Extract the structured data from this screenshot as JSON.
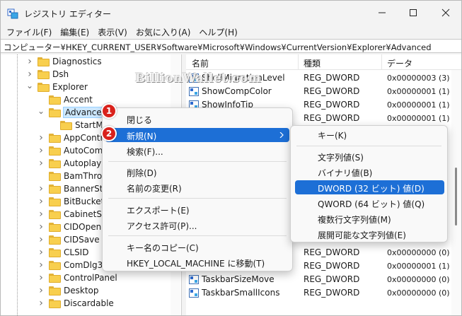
{
  "window": {
    "title": "レジストリ エディター"
  },
  "menu": [
    "ファイル(F)",
    "編集(E)",
    "表示(V)",
    "お気に入り(A)",
    "ヘルプ(H)"
  ],
  "address": "コンピューター¥HKEY_CURRENT_USER¥Software¥Microsoft¥Windows¥CurrentVersion¥Explorer¥Advanced",
  "tree": {
    "items": [
      {
        "label": "Diagnostics",
        "expander": "collapsed"
      },
      {
        "label": "Dsh",
        "expander": "collapsed"
      },
      {
        "label": "Explorer",
        "expander": "expanded"
      },
      {
        "label": "Accent",
        "expander": "none"
      },
      {
        "label": "Advanced",
        "expander": "expanded",
        "selected": true
      },
      {
        "label": "StartMo",
        "expander": "none"
      },
      {
        "label": "AppContra",
        "expander": "collapsed"
      },
      {
        "label": "AutoComp",
        "expander": "collapsed"
      },
      {
        "label": "AutoplayH",
        "expander": "collapsed"
      },
      {
        "label": "BamThrott",
        "expander": "none"
      },
      {
        "label": "BannerSto",
        "expander": "collapsed"
      },
      {
        "label": "BitBucket",
        "expander": "collapsed"
      },
      {
        "label": "CabinetSta",
        "expander": "collapsed"
      },
      {
        "label": "CIDOpen",
        "expander": "collapsed"
      },
      {
        "label": "CIDSave",
        "expander": "collapsed"
      },
      {
        "label": "CLSID",
        "expander": "collapsed"
      },
      {
        "label": "ComDlg32",
        "expander": "collapsed"
      },
      {
        "label": "ControlPanel",
        "expander": "collapsed"
      },
      {
        "label": "Desktop",
        "expander": "collapsed"
      },
      {
        "label": "Discardable",
        "expander": "collapsed"
      }
    ]
  },
  "list": {
    "columns": {
      "name": "名前",
      "type": "種類",
      "data": "データ"
    },
    "rows_top": [
      {
        "name": "ShellMigrationLevel",
        "type": "REG_DWORD",
        "data": "0x00000003 (3)"
      },
      {
        "name": "ShowCompColor",
        "type": "REG_DWORD",
        "data": "0x00000001 (1)"
      },
      {
        "name": "ShowInfoTip",
        "type": "REG_DWORD",
        "data": "0x00000001 (1)"
      },
      {
        "name": "",
        "type": "REG_DWORD",
        "data": "0x00000001 (1)"
      }
    ],
    "rows_bottom": [
      {
        "name": "",
        "type": "REG_DWORD",
        "data": "0x00000000 (0)"
      },
      {
        "name": "",
        "type": "REG_DWORD",
        "data": "0x00000001 (1)"
      },
      {
        "name": "TaskbarSizeMove",
        "type": "REG_DWORD",
        "data": "0x00000000 (0)"
      },
      {
        "name": "TaskbarSmallIcons",
        "type": "REG_DWORD",
        "data": "0x00000000 (0)"
      },
      {
        "name": "",
        "type": "",
        "data": ""
      }
    ]
  },
  "context_menu": {
    "items": [
      "閉じる",
      "新規(N)",
      "検索(F)...",
      "削除(D)",
      "名前の変更(R)",
      "エクスポート(E)",
      "アクセス許可(P)...",
      "キー名のコピー(C)",
      "HKEY_LOCAL_MACHINE に移動(T)"
    ],
    "highlighted": "新規(N)"
  },
  "submenu": {
    "items": [
      "キー(K)",
      "文字列値(S)",
      "バイナリ値(B)",
      "DWORD (32 ビット) 値(D)",
      "QWORD (64 ビット) 値(Q)",
      "複数行文字列値(M)",
      "展開可能な文字列値(E)"
    ],
    "highlighted": "DWORD (32 ビット) 値(D)"
  },
  "steps": [
    "1",
    "2"
  ],
  "watermark": "BillionWallet.com",
  "colors": {
    "highlight": "#1d6fd6",
    "badge": "#d9221c",
    "folder": "#f8cf4e"
  }
}
